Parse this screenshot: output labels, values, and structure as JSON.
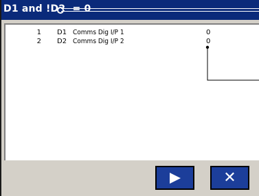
{
  "title": {
    "text": "D1 and !D2  = 0"
  },
  "rows": [
    {
      "num": "1",
      "tag": "D1",
      "desc": "Comms Dig I/P 1",
      "value": "0"
    },
    {
      "num": "2",
      "tag": "D2",
      "desc": "Comms Dig I/P 2",
      "value": "0"
    }
  ],
  "buttons": {
    "play_icon": "play-icon",
    "close_icon": "close-icon",
    "close_glyph": "✕"
  },
  "colors": {
    "titlebar": "#0a2a7a",
    "button": "#1c3e9a",
    "frame": "#d4d0c8"
  }
}
